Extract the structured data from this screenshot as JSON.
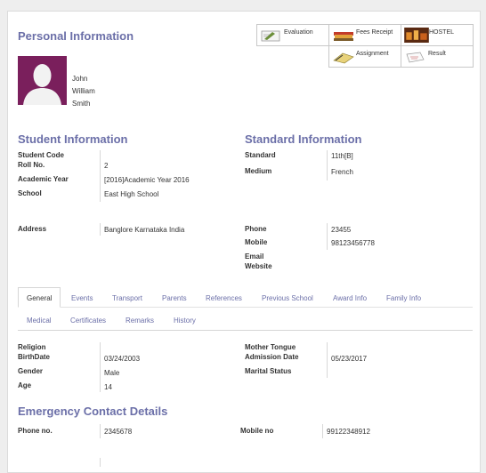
{
  "personal": {
    "title": "Personal Information",
    "name": [
      "John",
      "William",
      "Smith"
    ]
  },
  "quicklinks": [
    {
      "label": "Evaluation",
      "icon": "evaluation-icon"
    },
    {
      "label": "Fees Receipt",
      "icon": "fees-receipt-icon"
    },
    {
      "label": "HOSTEL",
      "icon": "hostel-icon"
    },
    {
      "label": "Assignment",
      "icon": "assignment-icon"
    },
    {
      "label": "Result",
      "icon": "result-icon"
    }
  ],
  "student": {
    "title": "Student Information",
    "code_label": "Student Code",
    "code_value": "",
    "roll_label": "Roll No.",
    "roll_value": "2",
    "year_label": "Academic Year",
    "year_value": "[2016]Academic Year 2016",
    "school_label": "School",
    "school_value": "East High School",
    "address_label": "Address",
    "address_value": "Banglore Karnataka India"
  },
  "standard": {
    "title": "Standard Information",
    "standard_label": "Standard",
    "standard_value": "11th[B]",
    "medium_label": "Medium",
    "medium_value": "French",
    "phone_label": "Phone",
    "phone_value": "23455",
    "mobile_label": "Mobile",
    "mobile_value": "98123456778",
    "email_label": "Email",
    "website_label": "Website"
  },
  "tabs": {
    "row1": [
      "General",
      "Events",
      "Transport",
      "Parents",
      "References",
      "Previous School",
      "Award Info",
      "Family Info"
    ],
    "row2": [
      "Medical",
      "Certificates",
      "Remarks",
      "History"
    ],
    "active": "General"
  },
  "general": {
    "religion_label": "Religion",
    "birthdate_label": "BirthDate",
    "birthdate_value": "03/24/2003",
    "gender_label": "Gender",
    "gender_value": "Male",
    "age_label": "Age",
    "age_value": "14",
    "tongue_label": "Mother Tongue",
    "admission_label": "Admission Date",
    "admission_value": "05/23/2017",
    "marital_label": "Marital Status"
  },
  "emergency": {
    "title": "Emergency Contact Details",
    "phone_label": "Phone no.",
    "phone_value": "2345678",
    "mobile_label": "Mobile no",
    "mobile_value": "99122348912"
  },
  "colors": {
    "accent": "#6b6fa8",
    "avatar_bg": "#7a1f5c"
  }
}
